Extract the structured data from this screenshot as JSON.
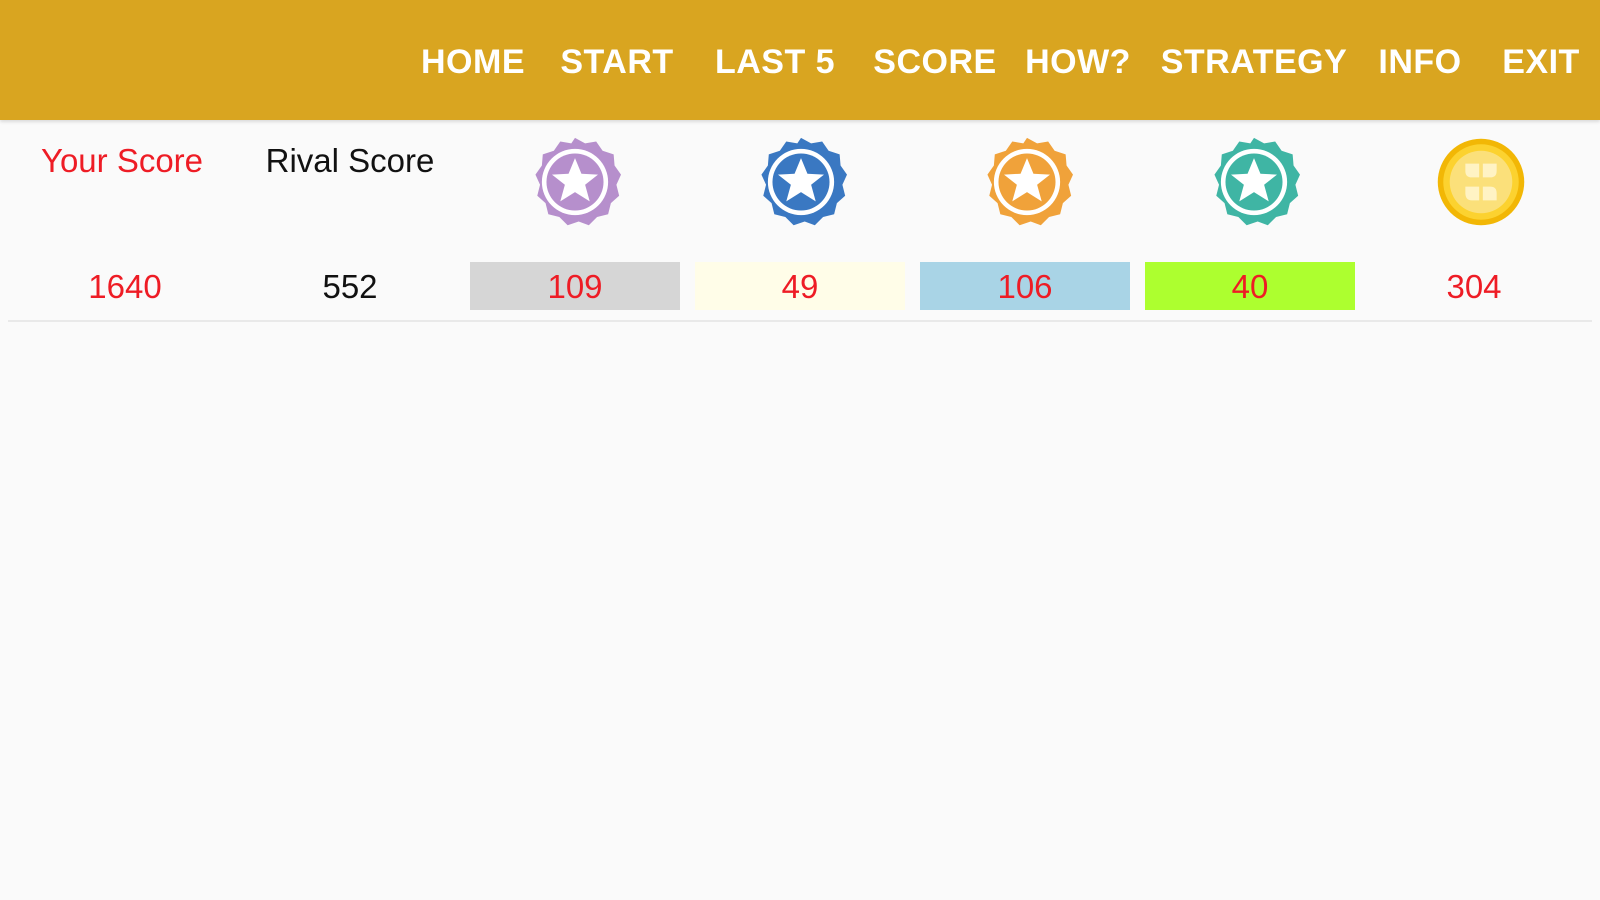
{
  "nav": {
    "items": [
      {
        "label": "HOME"
      },
      {
        "label": "START"
      },
      {
        "label": "LAST 5"
      },
      {
        "label": "SCORE"
      },
      {
        "label": "HOW?"
      },
      {
        "label": "STRATEGY"
      },
      {
        "label": "INFO"
      },
      {
        "label": "EXIT"
      }
    ]
  },
  "scoreboard": {
    "your_score_label": "Your Score",
    "rival_score_label": "Rival Score",
    "your_score": "1640",
    "rival_score": "552",
    "badges": [
      {
        "icon": "purple-star-badge-icon",
        "color": "#b68fcc",
        "value": "109",
        "cell_color": "#d6d6d6"
      },
      {
        "icon": "blue-star-badge-icon",
        "color": "#3a78c2",
        "value": "49",
        "cell_color": "#fffde8"
      },
      {
        "icon": "orange-star-badge-icon",
        "color": "#f0a23a",
        "value": "106",
        "cell_color": "#a9d4e6"
      },
      {
        "icon": "teal-star-badge-icon",
        "color": "#3fb5a4",
        "value": "40",
        "cell_color": "#adff2f"
      },
      {
        "icon": "gold-coin-icon",
        "color": "#f4c20d",
        "value": "304",
        "cell_color": ""
      }
    ]
  },
  "colors": {
    "topbar": "#d9a520",
    "accent_red": "#ee1c25",
    "background": "#fafafa"
  }
}
